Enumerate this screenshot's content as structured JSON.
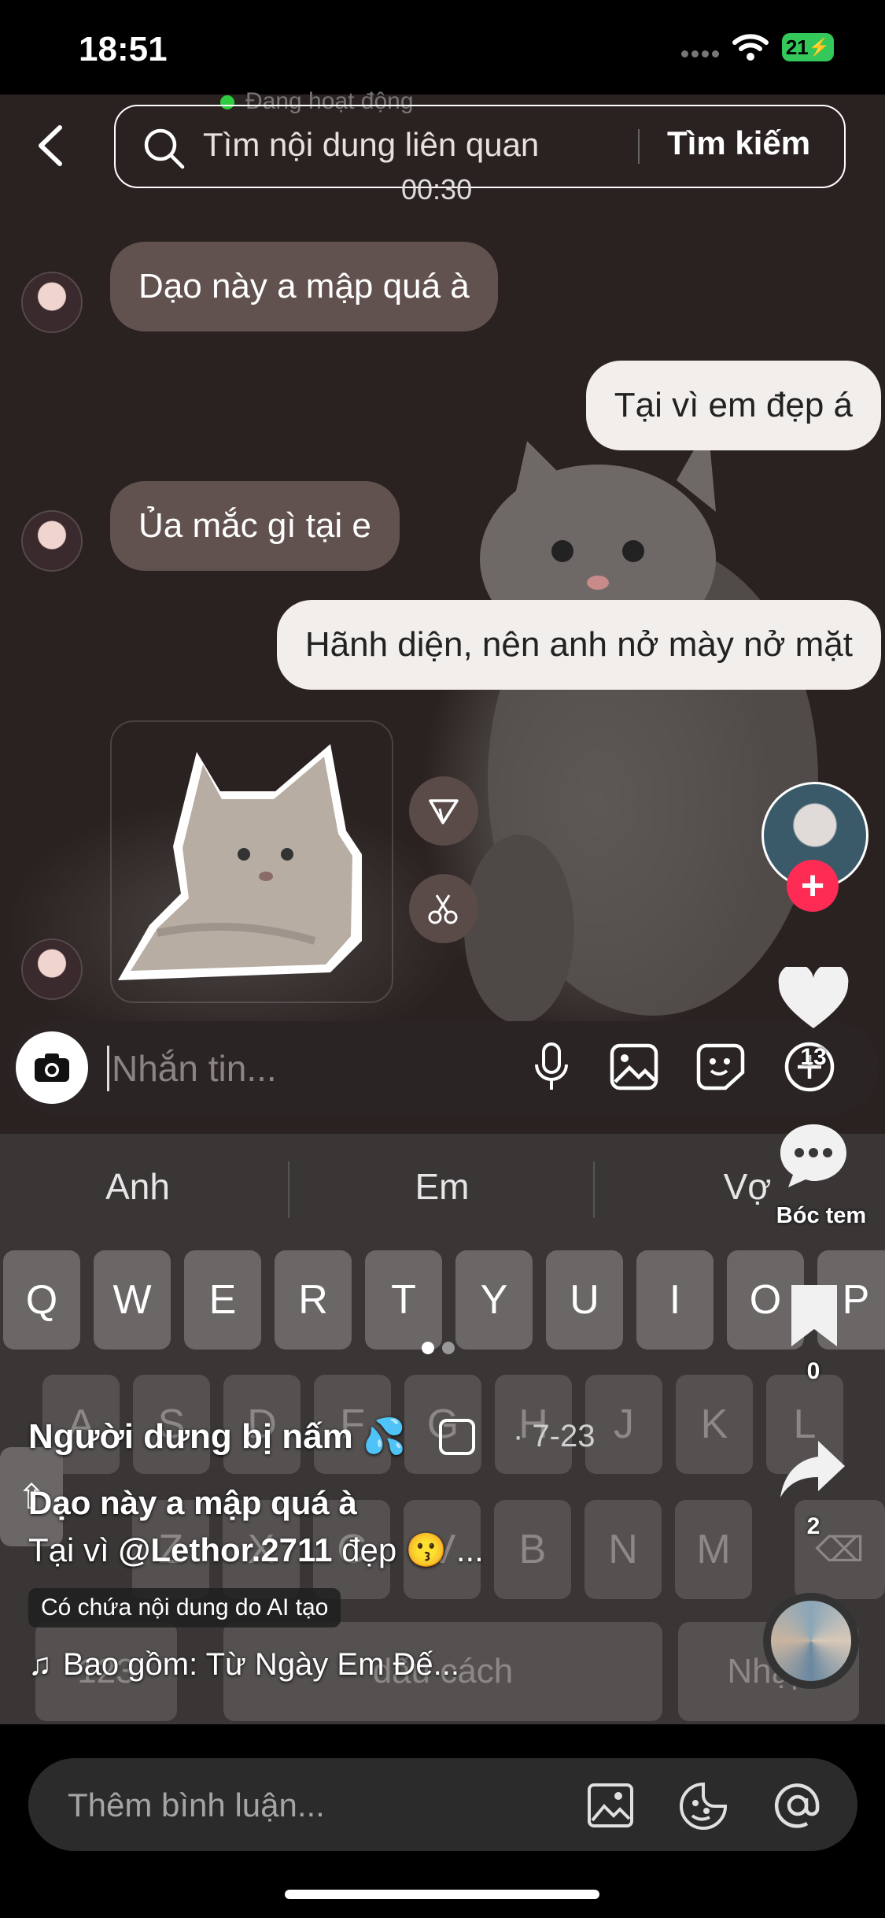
{
  "status_bar": {
    "time": "18:51",
    "battery": "21"
  },
  "chat_header": {
    "active_status": "Đang hoạt động"
  },
  "search": {
    "placeholder": "Tìm nội dung liên quan",
    "button": "Tìm kiếm",
    "timestamp": "00:30"
  },
  "messages": [
    {
      "side": "in",
      "text": "Dạo này a mập quá à"
    },
    {
      "side": "out",
      "text": "Tại vì em đẹp á"
    },
    {
      "side": "in",
      "text": "Ủa mắc gì tại e"
    },
    {
      "side": "out",
      "text": "Hãnh diện, nên anh nở mày nở mặt"
    }
  ],
  "message_input": {
    "placeholder": "Nhắn tin..."
  },
  "keyboard": {
    "suggestions": [
      "Anh",
      "Em",
      "Vợ"
    ],
    "row1": [
      "Q",
      "W",
      "E",
      "R",
      "T",
      "Y",
      "U",
      "I",
      "O",
      "P"
    ],
    "row2": [
      "A",
      "S",
      "D",
      "F",
      "G",
      "H",
      "J",
      "K",
      "L"
    ],
    "row3": [
      "Z",
      "X",
      "C",
      "V",
      "B",
      "N",
      "M"
    ],
    "num_key": "123",
    "space_key": "dấu cách",
    "return_key": "Nhập"
  },
  "rail": {
    "likes": "13",
    "comments_label": "Bóc tem",
    "saves": "0",
    "shares": "2"
  },
  "post": {
    "author": "Người dưng bị nấm 💦",
    "date": "· 7-23",
    "caption_title": "Dạo này a mập quá à",
    "caption_prefix": "Tại vì ",
    "caption_mention": "@Lethor.2711",
    "caption_suffix": " đẹp 😗 ...",
    "ai_label": "Có chứa nội dung do AI tạo",
    "music": "Bao gồm: Từ Ngày Em Đế..."
  },
  "comment_bar": {
    "placeholder": "Thêm bình luận..."
  },
  "colors": {
    "follow": "#fe2c55",
    "battery": "#34c759",
    "online": "#2ecc40"
  }
}
